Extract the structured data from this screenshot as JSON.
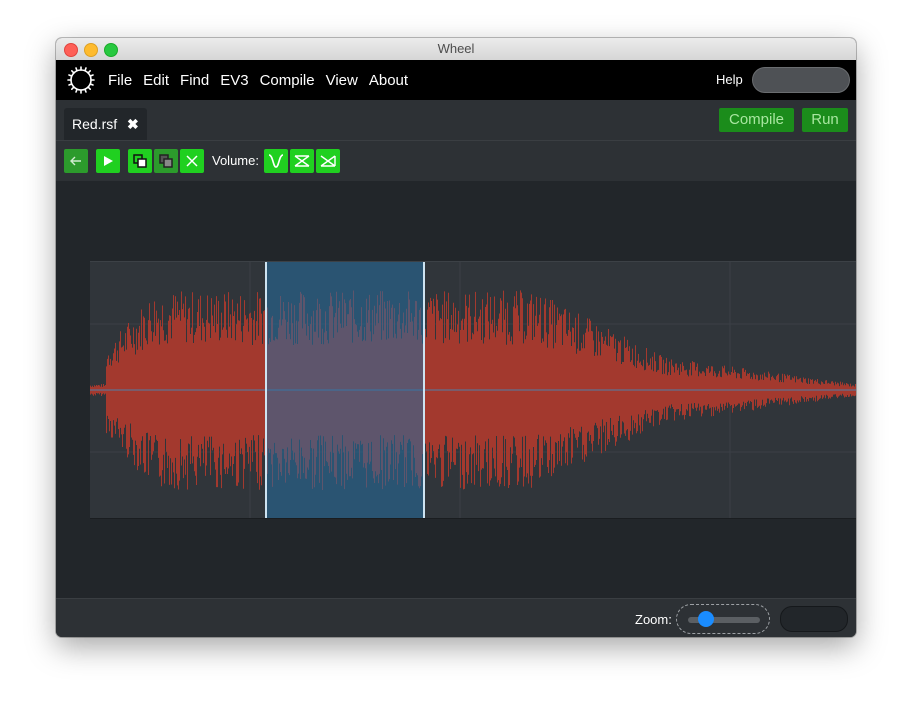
{
  "window": {
    "title": "Wheel"
  },
  "menu": {
    "items": [
      "File",
      "Edit",
      "Find",
      "EV3",
      "Compile",
      "View",
      "About"
    ],
    "help_label": "Help",
    "help_search_value": ""
  },
  "tabs": [
    {
      "label": "Red.rsf",
      "close_icon": "✖"
    }
  ],
  "actions": {
    "compile_label": "Compile",
    "run_label": "Run"
  },
  "toolbar": {
    "buttons": [
      "back-arrow-icon",
      "play-icon",
      "copy-icon",
      "paste-icon",
      "delete-icon"
    ],
    "volume_label": "Volume:",
    "volume_buttons": [
      "fade-curve-icon",
      "fade-in-icon",
      "fade-out-icon"
    ]
  },
  "waveform": {
    "selection_start_fraction": 0.229,
    "selection_end_fraction": 0.437,
    "colors": {
      "wave": "#a3392e",
      "selection": "#266ea0",
      "background": "#30353a"
    }
  },
  "status": {
    "zoom_label": "Zoom:",
    "zoom_level_fraction": 0.25,
    "zoom_field_value": ""
  },
  "colors": {
    "accent_green": "#20d020",
    "button_green": "#1b8c1b",
    "zoom_thumb": "#1a8cff"
  }
}
